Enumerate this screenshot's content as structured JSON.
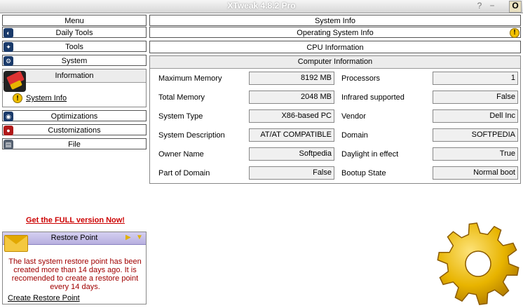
{
  "window": {
    "title": "XTweak 4.8.2 Pro",
    "help_label": "?",
    "minimize_label": "−",
    "close_label": "O"
  },
  "sidebar": {
    "menu_header": "Menu",
    "items": [
      {
        "label": "Daily Tools"
      },
      {
        "label": "Tools"
      },
      {
        "label": "System"
      }
    ],
    "information_label": "Information",
    "system_info_link": "System Info",
    "bottom_items": [
      {
        "label": "Optimizations"
      },
      {
        "label": "Customizations"
      },
      {
        "label": "File"
      }
    ],
    "promo_link": "Get the FULL version Now!",
    "restore": {
      "title": "Restore Point",
      "message": "The last system restore point has been created more than 14 days ago. It is recomended to create a restore point every 14 days.",
      "action": "Create Restore Point"
    }
  },
  "main": {
    "header": "System Info",
    "tabs": [
      {
        "label": "Operating System Info"
      },
      {
        "label": "CPU Information"
      }
    ],
    "section_title": "Computer Information",
    "left_fields": [
      {
        "label": "Maximum Memory",
        "value": "8192 MB"
      },
      {
        "label": "Total Memory",
        "value": "2048 MB"
      },
      {
        "label": "System Type",
        "value": "X86-based PC"
      },
      {
        "label": "System Description",
        "value": "AT/AT COMPATIBLE"
      },
      {
        "label": "Owner Name",
        "value": "Softpedia"
      },
      {
        "label": "Part of Domain",
        "value": "False"
      }
    ],
    "right_fields": [
      {
        "label": "Processors",
        "value": "1"
      },
      {
        "label": "Infrared supported",
        "value": "False"
      },
      {
        "label": "Vendor",
        "value": "Dell Inc"
      },
      {
        "label": "Domain",
        "value": "SOFTPEDIA"
      },
      {
        "label": "Daylight in effect",
        "value": "True"
      },
      {
        "label": "Bootup State",
        "value": "Normal boot"
      }
    ]
  },
  "colors": {
    "accent_red": "#cc0000",
    "gear_yellow": "#e8b400",
    "restore_header": "#b8b0e0"
  }
}
